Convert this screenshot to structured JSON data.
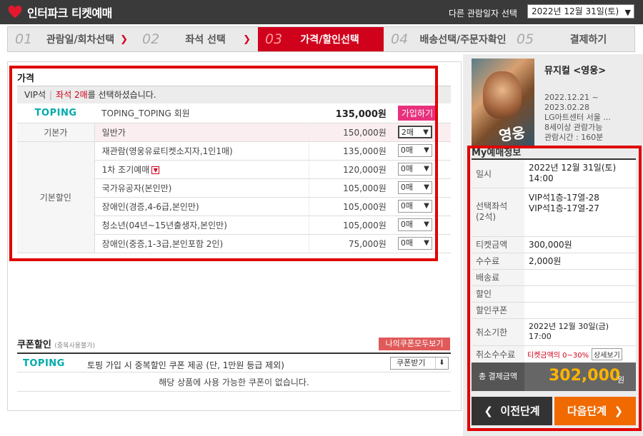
{
  "header": {
    "logo_text": "인터파크 티켓예매",
    "date_label": "다른 관람일자 선택",
    "date_value": "2022년 12월 31일(토)"
  },
  "steps": [
    {
      "num": "01",
      "label": "관람일/회차선택"
    },
    {
      "num": "02",
      "label": "좌석 선택"
    },
    {
      "num": "03",
      "label": "가격/할인선택"
    },
    {
      "num": "04",
      "label": "배송선택/주문자확인"
    },
    {
      "num": "05",
      "label": "결제하기"
    }
  ],
  "price_section": {
    "title": "가격",
    "grade": "VIP석",
    "selected_seats": "좌석 2매",
    "selected_suffix": "를 선택하셨습니다.",
    "toping": {
      "logo": "TOPING",
      "name": "TOPING_TOPING 회원",
      "price": "135,000원",
      "join_label": "가입하기"
    },
    "base": {
      "category": "기본가",
      "name": "일반가",
      "price": "150,000원",
      "qty": "2매"
    },
    "discount_category": "기본할인",
    "discounts": [
      {
        "name": "재관람(영웅유료티켓소지자,1인1매)",
        "price": "135,000원",
        "qty": "0매"
      },
      {
        "name": "1차 조기예매",
        "price": "120,000원",
        "qty": "0매"
      },
      {
        "name": "국가유공자(본인만)",
        "price": "105,000원",
        "qty": "0매"
      },
      {
        "name": "장애인(경증,4-6급,본인만)",
        "price": "105,000원",
        "qty": "0매"
      },
      {
        "name": "청소년(04년~15년출생자,본인만)",
        "price": "105,000원",
        "qty": "0매"
      },
      {
        "name": "장애인(중증,1-3급,본인포함 2인)",
        "price": "75,000원",
        "qty": "0매"
      }
    ]
  },
  "coupon": {
    "title": "쿠폰할인",
    "subtitle": "(중복사용불가)",
    "all_button": "나의쿠폰모두보기",
    "logo": "TOPING",
    "desc": "토핑 가입 시 중복할인 쿠폰 제공 (단, 1만원 등급 제외)",
    "receive_button": "쿠폰받기",
    "empty_text": "해당 상품에 사용 가능한 쿠폰이 없습니다."
  },
  "show": {
    "title": "뮤지컬 <영웅>",
    "poster_text": "영웅",
    "period": "2022.12.21 ~",
    "period_end": "2023.02.28",
    "venue": "LG아트센터 서울 ...",
    "age": "8세이상 관람가능",
    "runtime": "관람시간 : 160분"
  },
  "my_booking": {
    "title": "My예매정보",
    "rows": [
      {
        "key": "일시",
        "value": "2022년 12월 31일(토)",
        "value2": "14:00"
      },
      {
        "key": "선택좌석",
        "key2": "(2석)",
        "value": "VIP석1층-17열-28",
        "value2": "VIP석1층-17열-27"
      },
      {
        "key": "티켓금액",
        "value": "300,000원"
      },
      {
        "key": "수수료",
        "value": "2,000원"
      },
      {
        "key": "배송료",
        "value": ""
      },
      {
        "key": "할인",
        "value": ""
      },
      {
        "key": "할인쿠폰",
        "value": ""
      },
      {
        "key": "취소기한",
        "value": "2022년 12월 30일(금)",
        "value2": "17:00"
      },
      {
        "key": "취소수수료",
        "value": "티켓금액의 0~30%",
        "button": "상세보기"
      }
    ],
    "total_label": "총 결제금액",
    "total_amount": "302,000",
    "total_unit": "원"
  },
  "nav": {
    "prev": "이전단계",
    "next": "다음단계"
  },
  "colors": {
    "accent": "#d0011b",
    "next_button": "#f06a00",
    "highlight_box": "#e00000",
    "total_amount": "#ffb400"
  }
}
